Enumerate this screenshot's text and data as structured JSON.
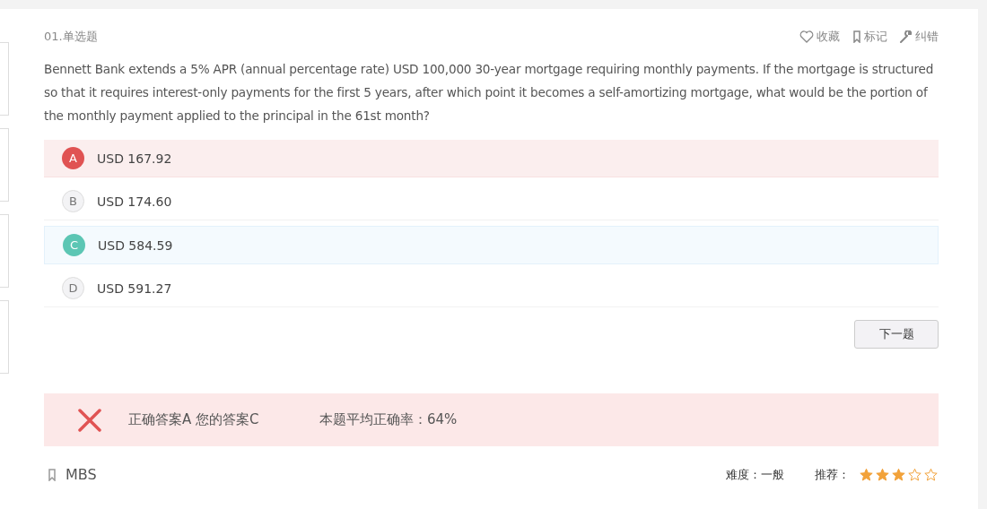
{
  "question": {
    "number": "01.单选题",
    "actions": [
      {
        "kind": "favorite",
        "label": "收藏"
      },
      {
        "kind": "mark",
        "label": "标记"
      },
      {
        "kind": "report",
        "label": "纠错"
      }
    ],
    "text": "Bennett Bank extends a 5% APR (annual percentage rate) USD 100,000 30-year mortgage requiring monthly payments. If the mortgage is structured so that it requires interest-only payments for the first 5 years, after which point it becomes a self-amortizing mortgage, what would be the portion of the monthly payment applied to the principal in the 61st month?",
    "options": [
      {
        "letter": "A",
        "text": "USD 167.92",
        "correct": true,
        "selected": false
      },
      {
        "letter": "B",
        "text": "USD 174.60",
        "correct": false,
        "selected": false
      },
      {
        "letter": "C",
        "text": "USD 584.59",
        "correct": false,
        "selected": true
      },
      {
        "letter": "D",
        "text": "USD 591.27",
        "correct": false,
        "selected": false
      }
    ],
    "next_button": "下一题"
  },
  "result": {
    "correct": false,
    "answer_text": "正确答案A 您的答案C",
    "accuracy_text": "本题平均正确率：64%"
  },
  "footer": {
    "tag": "MBS",
    "difficulty": "难度：一般",
    "recommend_label": "推荐：",
    "stars": 3
  }
}
